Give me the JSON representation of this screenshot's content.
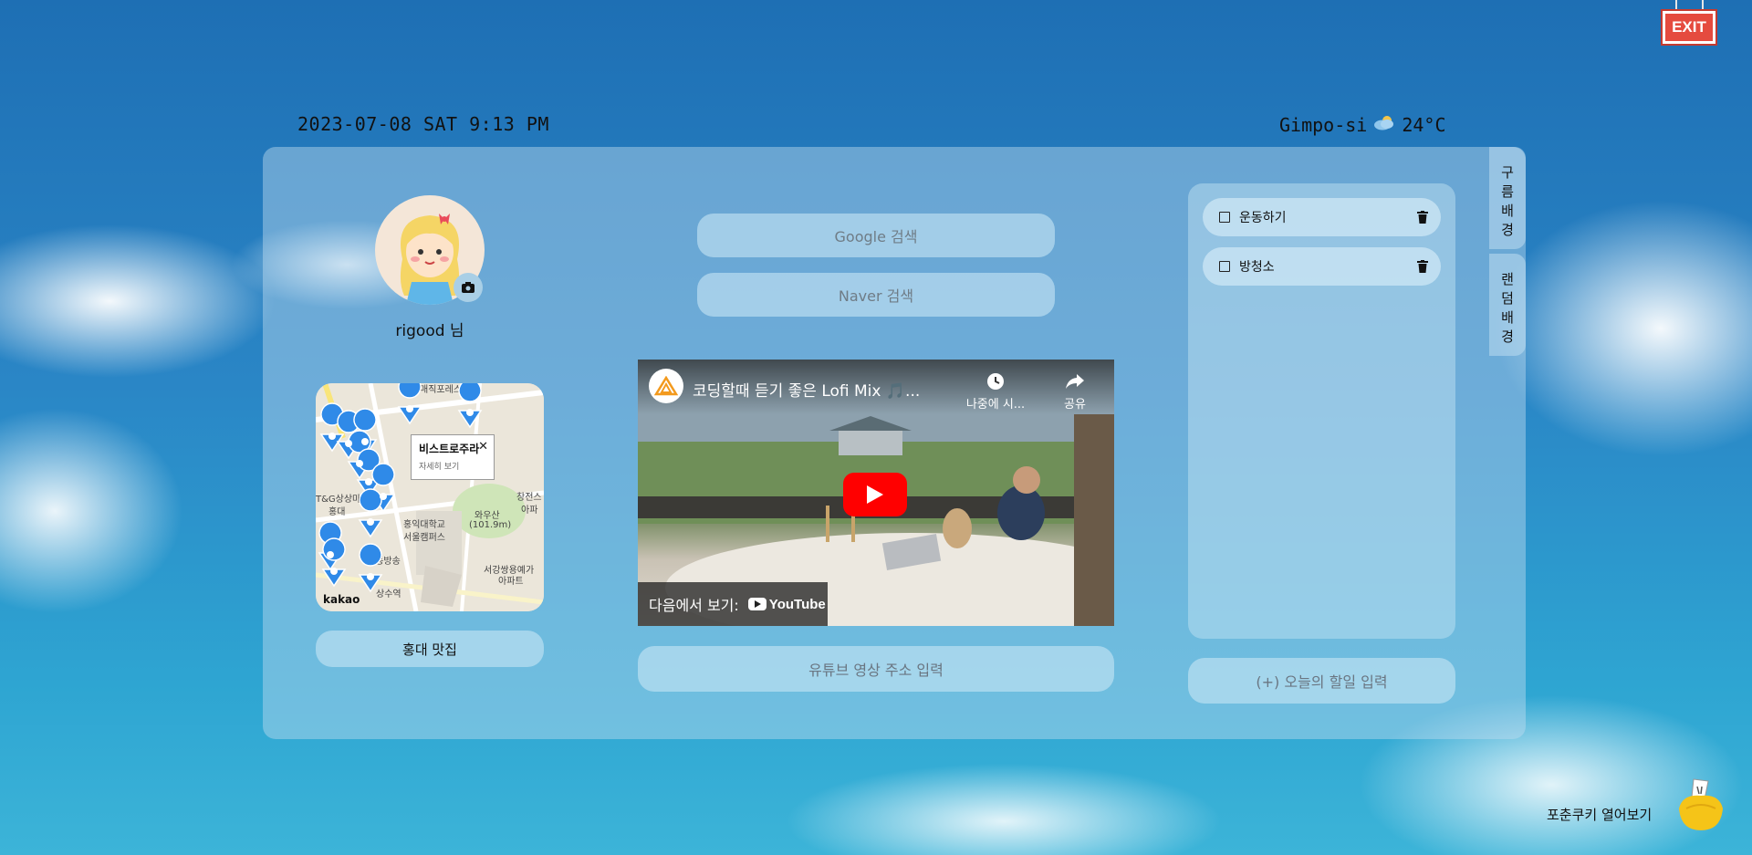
{
  "exit": {
    "label": "EXIT"
  },
  "header": {
    "datetime": "2023-07-08 SAT 9:13 PM",
    "location": "Gimpo-si",
    "temperature": "24°C",
    "weather_icon": "cloud-sun-icon"
  },
  "side_tabs": [
    {
      "label": [
        "구",
        "름",
        "배",
        "경"
      ]
    },
    {
      "label": [
        "랜",
        "덤",
        "배",
        "경"
      ]
    }
  ],
  "profile": {
    "name": "rigood 님"
  },
  "map": {
    "popup_title": "비스트로주라",
    "popup_link": "자세히 보기",
    "close": "✕",
    "brand": "kakao",
    "labels": [
      "매직포레스트",
      "T&G상상마당",
      "홍대",
      "홍익대학교",
      "서울캠퍼스",
      "와우산",
      "(101.9m)",
      "극동방송",
      "서강쌍용예가",
      "아파트",
      "창전스",
      "아파",
      "상수역"
    ]
  },
  "map_button": {
    "label": "홍대 맛집"
  },
  "search": {
    "google": "Google 검색",
    "naver": "Naver 검색"
  },
  "video": {
    "title": "코딩할때 듣기 좋은 Lofi Mix 🎵...",
    "watch_later": "나중에 시...",
    "share": "공유",
    "watch_on": "다음에서 보기:",
    "youtube": "YouTube"
  },
  "youtube_input": {
    "placeholder": "유튜브 영상 주소 입력"
  },
  "todos": [
    {
      "label": "운동하기",
      "checked": false
    },
    {
      "label": "방청소",
      "checked": false
    }
  ],
  "todo_input": {
    "placeholder": "(+) 오늘의 할일 입력"
  },
  "fortune": {
    "label": "포춘쿠키 열어보기"
  },
  "colors": {
    "exit": "#e54b3f",
    "youtube_red": "#ff0000",
    "pin": "#2f8ae8"
  }
}
